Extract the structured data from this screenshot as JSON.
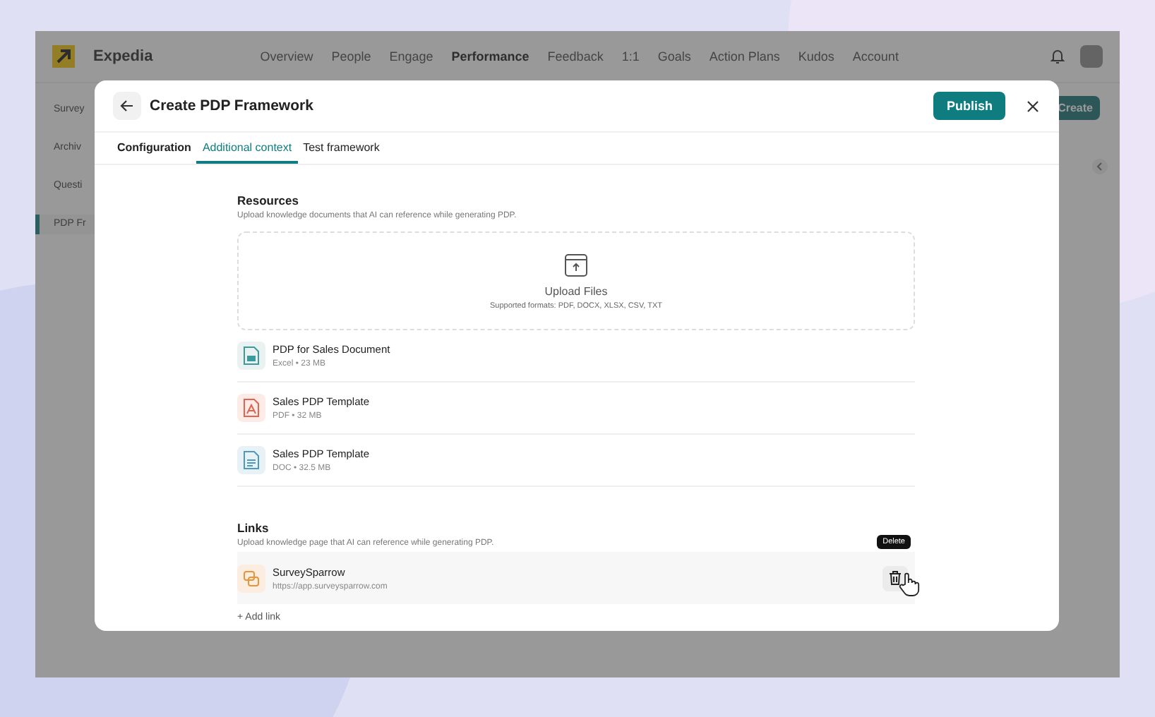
{
  "app": {
    "brand": "Expedia",
    "nav": [
      {
        "label": "Overview",
        "selected": false
      },
      {
        "label": "People",
        "selected": false
      },
      {
        "label": "Engage",
        "selected": false
      },
      {
        "label": "Performance",
        "selected": true
      },
      {
        "label": "Feedback",
        "selected": false
      },
      {
        "label": "1:1",
        "selected": false
      },
      {
        "label": "Goals",
        "selected": false
      },
      {
        "label": "Action Plans",
        "selected": false
      },
      {
        "label": "Kudos",
        "selected": false
      },
      {
        "label": "Account",
        "selected": false
      }
    ],
    "sidebar": [
      {
        "label": "Survey",
        "selected": false
      },
      {
        "label": "Archiv",
        "selected": false
      },
      {
        "label": "Questi",
        "selected": false
      },
      {
        "label": "PDP Fr",
        "selected": true
      }
    ],
    "create_button": "Create"
  },
  "modal": {
    "title": "Create PDP Framework",
    "publish_button": "Publish",
    "tabs": [
      {
        "label": "Configuration",
        "selected": false
      },
      {
        "label": "Additional context",
        "selected": true
      },
      {
        "label": "Test framework",
        "selected": false
      }
    ],
    "resources": {
      "title": "Resources",
      "description": "Upload knowledge documents that AI can reference while generating PDP.",
      "upload": {
        "title": "Upload Files",
        "formats": "Supported formats: PDF, DOCX, XLSX, CSV, TXT"
      },
      "files": [
        {
          "kind": "sheet",
          "color": "#3a9a9c",
          "name": "PDP for Sales Document",
          "meta": "Excel • 23 MB"
        },
        {
          "kind": "pdf",
          "color": "#e0644f",
          "name": "Sales PDP Template",
          "meta": "PDF • 32 MB"
        },
        {
          "kind": "doc",
          "color": "#4a9cb8",
          "name": "Sales PDP Template",
          "meta": "DOC • 32.5 MB"
        }
      ]
    },
    "links": {
      "title": "Links",
      "description": "Upload knowledge page that AI can reference while generating PDP.",
      "items": [
        {
          "name": "SurveySparrow",
          "url": "https://app.surveysparrow.com",
          "tooltip": "Delete"
        }
      ],
      "add_link": "+ Add link"
    }
  }
}
